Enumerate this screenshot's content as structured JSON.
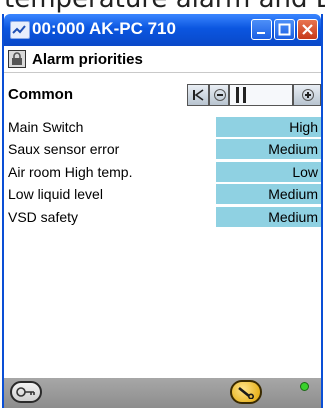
{
  "caption": {
    "text": "temperature alarm and Di"
  },
  "window": {
    "title": "00:000 AK-PC 710"
  },
  "subheader": {
    "title": "Alarm priorities"
  },
  "group": {
    "label": "Common"
  },
  "alarms": [
    {
      "label": "Main Switch",
      "value": "High"
    },
    {
      "label": "Saux sensor error",
      "value": "Medium"
    },
    {
      "label": "Air room High temp.",
      "value": "Low"
    },
    {
      "label": "Low liquid level",
      "value": "Medium"
    },
    {
      "label": "VSD safety",
      "value": "Medium"
    }
  ],
  "colors": {
    "titlebar": "#0b56e0",
    "value_cell": "#8fd1e2",
    "footer": "#9a9a9a",
    "status_led": "#39d12c"
  }
}
